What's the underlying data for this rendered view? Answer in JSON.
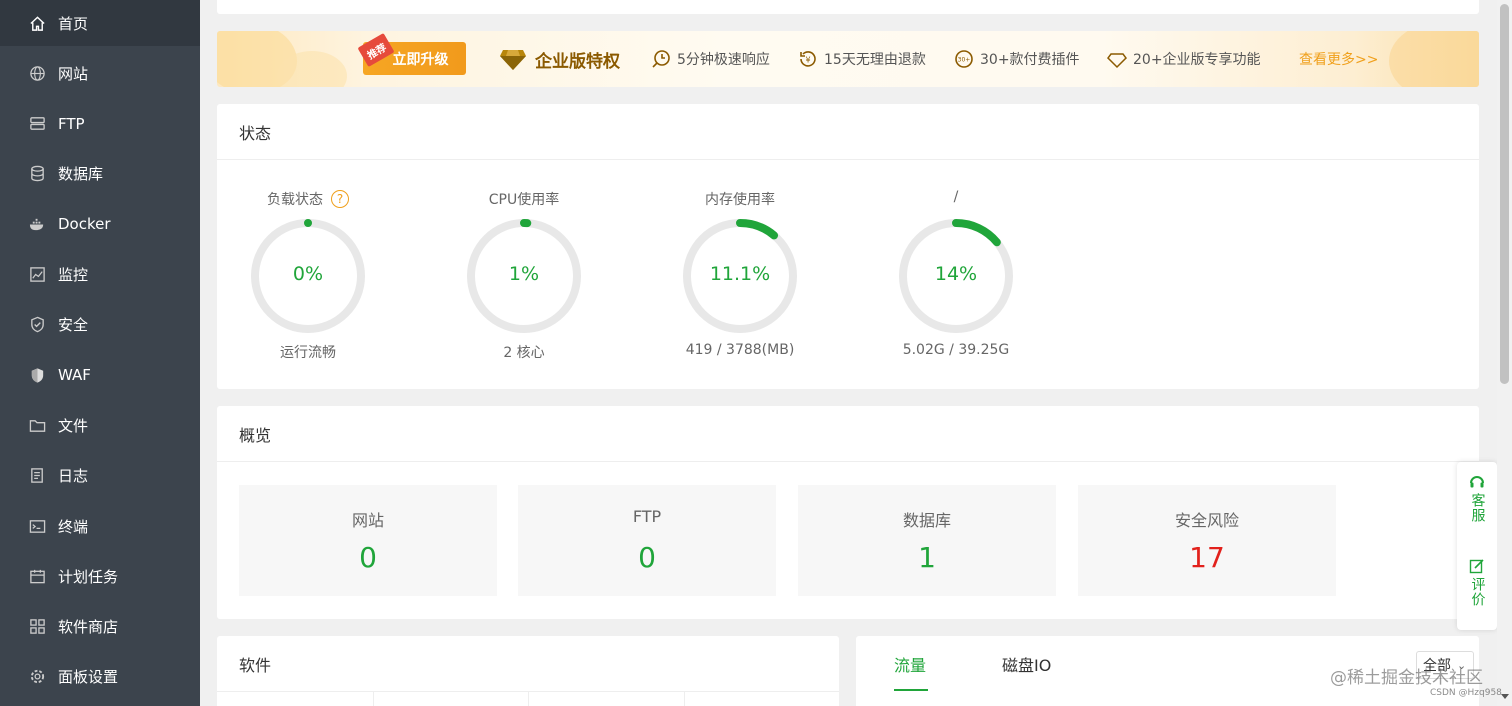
{
  "sidebar": {
    "items": [
      {
        "label": "首页",
        "icon": "home-icon",
        "active": true
      },
      {
        "label": "网站",
        "icon": "globe-icon"
      },
      {
        "label": "FTP",
        "icon": "ftp-icon"
      },
      {
        "label": "数据库",
        "icon": "database-icon"
      },
      {
        "label": "Docker",
        "icon": "docker-icon"
      },
      {
        "label": "监控",
        "icon": "monitor-icon"
      },
      {
        "label": "安全",
        "icon": "shield-icon"
      },
      {
        "label": "WAF",
        "icon": "waf-shield-icon"
      },
      {
        "label": "文件",
        "icon": "folder-icon"
      },
      {
        "label": "日志",
        "icon": "log-icon"
      },
      {
        "label": "终端",
        "icon": "terminal-icon"
      },
      {
        "label": "计划任务",
        "icon": "calendar-icon"
      },
      {
        "label": "软件商店",
        "icon": "apps-icon"
      },
      {
        "label": "面板设置",
        "icon": "gear-icon"
      }
    ]
  },
  "banner": {
    "recommend_tag": "推荐",
    "upgrade_label": "立即升级",
    "title": "企业版特权",
    "features": [
      {
        "text": "5分钟极速响应",
        "icon": "fast-response-icon"
      },
      {
        "text": "15天无理由退款",
        "icon": "refund-icon"
      },
      {
        "text": "30+款付费插件",
        "icon": "plugin-icon"
      },
      {
        "text": "20+企业版专享功能",
        "icon": "diamond-icon"
      }
    ],
    "more_label": "查看更多>>"
  },
  "status": {
    "title": "状态",
    "gauges": [
      {
        "label": "负载状态",
        "value_text": "0%",
        "percent": 0,
        "sub": "运行流畅",
        "help": "?"
      },
      {
        "label": "CPU使用率",
        "value_text": "1%",
        "percent": 1,
        "sub": "2 核心"
      },
      {
        "label": "内存使用率",
        "value_text": "11.1%",
        "percent": 11.1,
        "sub": "419 / 3788(MB)"
      },
      {
        "label": "/",
        "value_text": "14%",
        "percent": 14,
        "sub": "5.02G / 39.25G"
      }
    ],
    "colors": {
      "ok": "#20a53a",
      "track": "#e8e8e8"
    }
  },
  "overview": {
    "title": "概览",
    "items": [
      {
        "label": "网站",
        "value": "0"
      },
      {
        "label": "FTP",
        "value": "0"
      },
      {
        "label": "数据库",
        "value": "1"
      },
      {
        "label": "安全风险",
        "value": "17",
        "danger": true
      }
    ]
  },
  "software": {
    "title": "软件"
  },
  "traffic": {
    "tabs": [
      {
        "label": "流量",
        "active": true
      },
      {
        "label": "磁盘IO"
      }
    ],
    "select_value": "全部"
  },
  "float_panel": {
    "service_label": "客服",
    "review_label": "评价"
  },
  "watermark": {
    "main": "@稀土掘金技术社区",
    "sub": "CSDN @Hzq958"
  }
}
